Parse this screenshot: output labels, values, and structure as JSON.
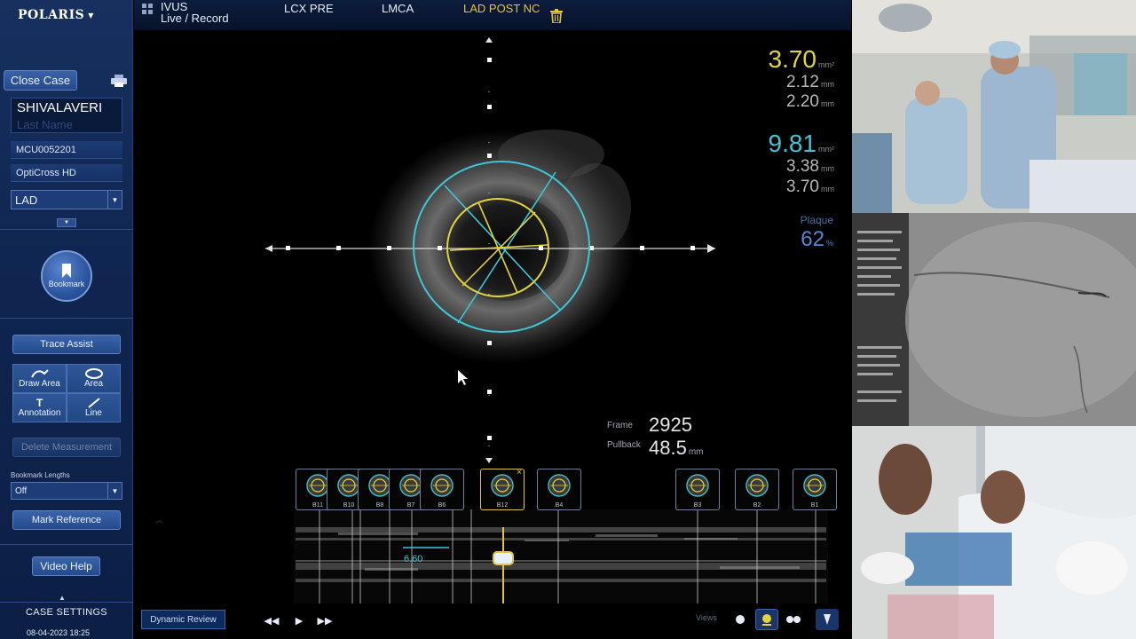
{
  "sidebar": {
    "brand": "POLARIS",
    "close_case_label": "Close Case",
    "patient_first_name": "SHIVALAVERI",
    "patient_last_name_placeholder": "Last Name",
    "patient_id": "MCU0052201",
    "catheter": "OptiCross HD",
    "vessel_select": "LAD",
    "bookmark_label": "Bookmark",
    "trace_assist_label": "Trace Assist",
    "tools": {
      "draw_area": "Draw Area",
      "area": "Area",
      "annotation": "Annotation",
      "line": "Line",
      "annotation_glyph": "T"
    },
    "delete_measurement_label": "Delete Measurement",
    "bookmark_lengths_label": "Bookmark Lengths",
    "bookmark_lengths_value": "Off",
    "mark_reference_label": "Mark Reference",
    "video_help_label": "Video Help",
    "case_settings_label": "CASE SETTINGS",
    "date": "08-04-2023 18:25"
  },
  "tabs": {
    "ivus_line1": "IVUS",
    "ivus_line2": "Live / Record",
    "lcx_pre": "LCX PRE",
    "lmca": "LMCA",
    "lad_post_nc": "LAD POST NC"
  },
  "measurements": {
    "lumen_area": "3.70",
    "lumen_area_unit": "mm²",
    "lumen_min": "2.12",
    "lumen_max": "2.20",
    "vessel_area": "9.81",
    "vessel_area_unit": "mm²",
    "vessel_min": "3.38",
    "vessel_max": "3.70",
    "mm_unit": "mm",
    "plaque_label": "Plaque",
    "plaque_value": "62",
    "plaque_unit": "%",
    "lumen_color": "#e3d43f",
    "vessel_color": "#3fc6d6"
  },
  "frame": {
    "frame_label": "Frame",
    "frame_value": "2925",
    "pullback_label": "Pullback",
    "pullback_value": "48.5",
    "pullback_unit": "mm"
  },
  "bookmarks": [
    {
      "label": "B11"
    },
    {
      "label": "B10"
    },
    {
      "label": "B8"
    },
    {
      "label": "B7"
    },
    {
      "label": "B6"
    },
    {
      "label": "B12"
    },
    {
      "label": "B4"
    },
    {
      "label": "B3"
    },
    {
      "label": "B2"
    },
    {
      "label": "B1"
    }
  ],
  "longview": {
    "length_label": "6.60"
  },
  "bottom": {
    "dynamic_review_label": "Dynamic Review",
    "views_label": "Views"
  }
}
